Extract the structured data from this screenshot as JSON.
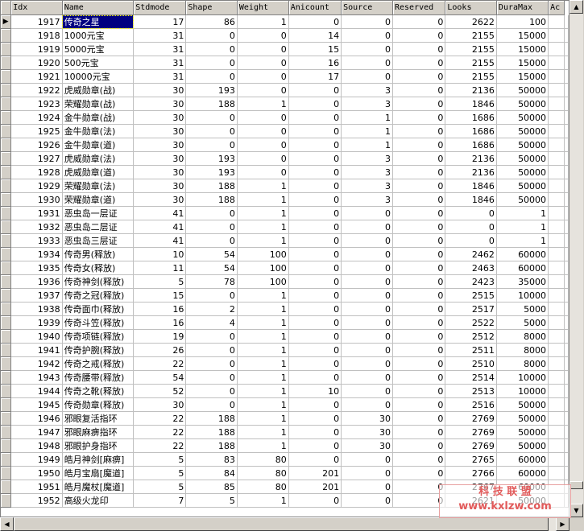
{
  "columns": [
    "Idx",
    "Name",
    "Stdmode",
    "Shape",
    "Weight",
    "Anicount",
    "Source",
    "Reserved",
    "Looks",
    "DuraMax",
    "Ac"
  ],
  "rows": [
    [
      "1917",
      "传奇之星",
      "17",
      "86",
      "1",
      "0",
      "0",
      "0",
      "2622",
      "100"
    ],
    [
      "1918",
      "1000元宝",
      "31",
      "0",
      "0",
      "14",
      "0",
      "0",
      "2155",
      "15000"
    ],
    [
      "1919",
      "5000元宝",
      "31",
      "0",
      "0",
      "15",
      "0",
      "0",
      "2155",
      "15000"
    ],
    [
      "1920",
      "500元宝",
      "31",
      "0",
      "0",
      "16",
      "0",
      "0",
      "2155",
      "15000"
    ],
    [
      "1921",
      "10000元宝",
      "31",
      "0",
      "0",
      "17",
      "0",
      "0",
      "2155",
      "15000"
    ],
    [
      "1922",
      "虎威勋章(战)",
      "30",
      "193",
      "0",
      "0",
      "3",
      "0",
      "2136",
      "50000"
    ],
    [
      "1923",
      "荣耀勋章(战)",
      "30",
      "188",
      "1",
      "0",
      "3",
      "0",
      "1846",
      "50000"
    ],
    [
      "1924",
      "金牛勋章(战)",
      "30",
      "0",
      "0",
      "0",
      "1",
      "0",
      "1686",
      "50000"
    ],
    [
      "1925",
      "金牛勋章(法)",
      "30",
      "0",
      "0",
      "0",
      "1",
      "0",
      "1686",
      "50000"
    ],
    [
      "1926",
      "金牛勋章(道)",
      "30",
      "0",
      "0",
      "0",
      "1",
      "0",
      "1686",
      "50000"
    ],
    [
      "1927",
      "虎威勋章(法)",
      "30",
      "193",
      "0",
      "0",
      "3",
      "0",
      "2136",
      "50000"
    ],
    [
      "1928",
      "虎威勋章(道)",
      "30",
      "193",
      "0",
      "0",
      "3",
      "0",
      "2136",
      "50000"
    ],
    [
      "1929",
      "荣耀勋章(法)",
      "30",
      "188",
      "1",
      "0",
      "3",
      "0",
      "1846",
      "50000"
    ],
    [
      "1930",
      "荣耀勋章(道)",
      "30",
      "188",
      "1",
      "0",
      "3",
      "0",
      "1846",
      "50000"
    ],
    [
      "1931",
      "恶虫岛一层证",
      "41",
      "0",
      "1",
      "0",
      "0",
      "0",
      "0",
      "1"
    ],
    [
      "1932",
      "恶虫岛二层证",
      "41",
      "0",
      "1",
      "0",
      "0",
      "0",
      "0",
      "1"
    ],
    [
      "1933",
      "恶虫岛三层证",
      "41",
      "0",
      "1",
      "0",
      "0",
      "0",
      "0",
      "1"
    ],
    [
      "1934",
      "传奇男(释放)",
      "10",
      "54",
      "100",
      "0",
      "0",
      "0",
      "2462",
      "60000"
    ],
    [
      "1935",
      "传奇女(释放)",
      "11",
      "54",
      "100",
      "0",
      "0",
      "0",
      "2463",
      "60000"
    ],
    [
      "1936",
      "传奇神剑(释放)",
      "5",
      "78",
      "100",
      "0",
      "0",
      "0",
      "2423",
      "35000"
    ],
    [
      "1937",
      "传奇之冠(释放)",
      "15",
      "0",
      "1",
      "0",
      "0",
      "0",
      "2515",
      "10000"
    ],
    [
      "1938",
      "传奇面巾(释放)",
      "16",
      "2",
      "1",
      "0",
      "0",
      "0",
      "2517",
      "5000"
    ],
    [
      "1939",
      "传奇斗笠(释放)",
      "16",
      "4",
      "1",
      "0",
      "0",
      "0",
      "2522",
      "5000"
    ],
    [
      "1940",
      "传奇项链(释放)",
      "19",
      "0",
      "1",
      "0",
      "0",
      "0",
      "2512",
      "8000"
    ],
    [
      "1941",
      "传奇护腕(释放)",
      "26",
      "0",
      "1",
      "0",
      "0",
      "0",
      "2511",
      "8000"
    ],
    [
      "1942",
      "传奇之戒(释放)",
      "22",
      "0",
      "1",
      "0",
      "0",
      "0",
      "2510",
      "8000"
    ],
    [
      "1943",
      "传奇腰带(释放)",
      "54",
      "0",
      "1",
      "0",
      "0",
      "0",
      "2514",
      "10000"
    ],
    [
      "1944",
      "传奇之靴(释放)",
      "52",
      "0",
      "1",
      "10",
      "0",
      "0",
      "2513",
      "10000"
    ],
    [
      "1945",
      "传奇勋章(释放)",
      "30",
      "0",
      "1",
      "0",
      "0",
      "0",
      "2516",
      "50000"
    ],
    [
      "1946",
      "邪眼复活指环",
      "22",
      "188",
      "1",
      "0",
      "30",
      "0",
      "2769",
      "50000"
    ],
    [
      "1947",
      "邪眼麻痹指环",
      "22",
      "188",
      "1",
      "0",
      "30",
      "0",
      "2769",
      "50000"
    ],
    [
      "1948",
      "邪眼护身指环",
      "22",
      "188",
      "1",
      "0",
      "30",
      "0",
      "2769",
      "50000"
    ],
    [
      "1949",
      "皓月神剑[麻痹]",
      "5",
      "83",
      "80",
      "0",
      "0",
      "0",
      "2765",
      "60000"
    ],
    [
      "1950",
      "皓月宝扇[魔道]",
      "5",
      "84",
      "80",
      "201",
      "0",
      "0",
      "2766",
      "60000"
    ],
    [
      "1951",
      "皓月魔杖[魔道]",
      "5",
      "85",
      "80",
      "201",
      "0",
      "0",
      "2767",
      "60000"
    ],
    [
      "1952",
      "高级火龙印",
      "7",
      "5",
      "1",
      "0",
      "0",
      "0",
      "2621",
      "50000"
    ]
  ],
  "current_row_marker": "▶",
  "selected_cell_text": "传奇之星",
  "scrollbar": {
    "up": "▲",
    "down": "▼",
    "left": "◀",
    "right": "▶"
  },
  "watermark": {
    "line1": "科 技 联 盟",
    "line2": "www.kxlzw.com"
  }
}
